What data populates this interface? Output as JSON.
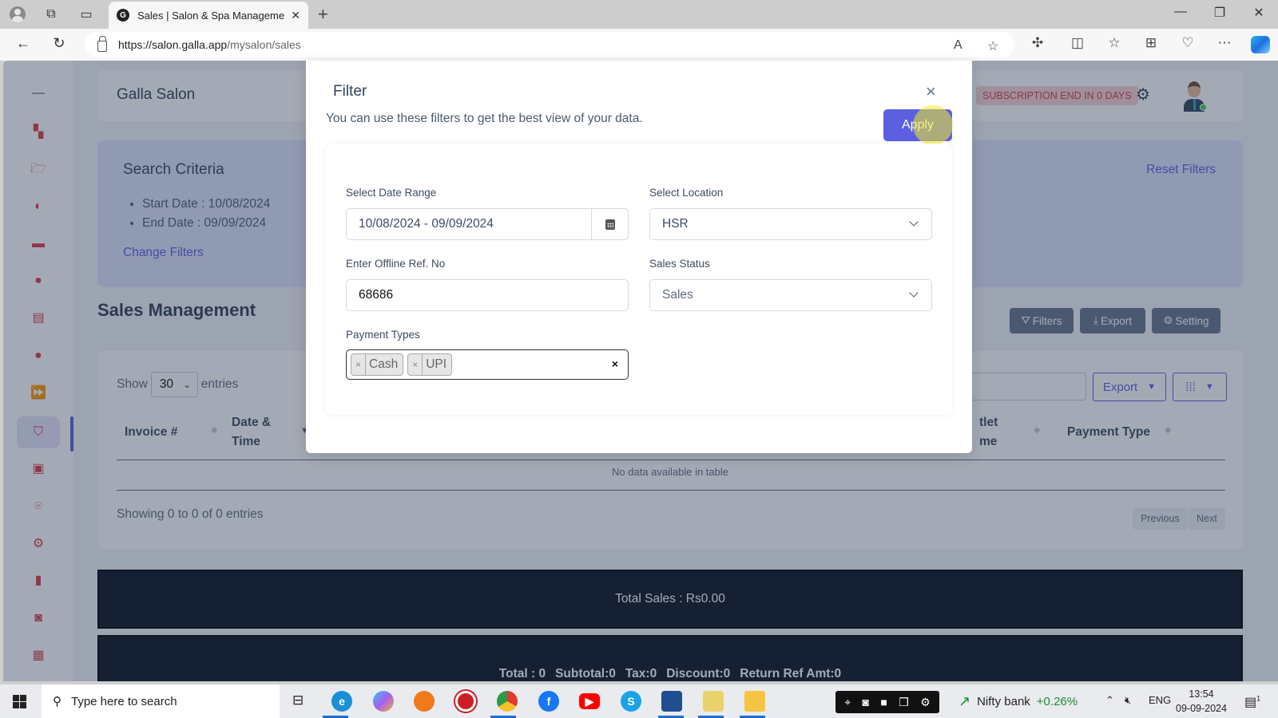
{
  "browser": {
    "tab_title": "Sales | Salon & Spa Management",
    "url_host": "https://salon.galla.app",
    "url_path": "/mysalon/sales",
    "new_tab": "+",
    "close_tab": "✕"
  },
  "header": {
    "brand": "Galla Salon",
    "subscription_badge": "SUBSCRIPTION END IN 0 DAYS",
    "subscription_color": "#d7373f"
  },
  "sidebar": {
    "items": [
      {
        "icon": "dashboard-icon",
        "glyph": "▚"
      },
      {
        "icon": "folder-open-icon",
        "glyph": "🗁"
      },
      {
        "icon": "contrast-icon",
        "glyph": "◐"
      },
      {
        "icon": "ticket-percent-icon",
        "glyph": "▬"
      },
      {
        "icon": "user-circle-icon",
        "glyph": "●"
      },
      {
        "icon": "document-icon",
        "glyph": "▤"
      },
      {
        "icon": "user-circle-icon",
        "glyph": "●"
      },
      {
        "icon": "fast-forward-circle-icon",
        "glyph": "⏩"
      },
      {
        "icon": "basket-icon",
        "glyph": "⛉",
        "active": true
      },
      {
        "icon": "contacts-book-icon",
        "glyph": "▣"
      },
      {
        "icon": "location-pin-icon",
        "glyph": "⌾"
      },
      {
        "icon": "gear-icon",
        "glyph": "⚙"
      },
      {
        "icon": "report-file-icon",
        "glyph": "▮"
      },
      {
        "icon": "cash-icon",
        "glyph": "◙"
      },
      {
        "icon": "calendar-icon",
        "glyph": "▦"
      }
    ],
    "accent_color": "#d93b48"
  },
  "criteria": {
    "title": "Search Criteria",
    "items": [
      "Start Date : 10/08/2024",
      "End Date : 09/09/2024"
    ],
    "change_link": "Change Filters",
    "reset_link": "Reset Filters"
  },
  "sales": {
    "title": "Sales Management",
    "actions": {
      "filters": "Filters",
      "export": "Export",
      "setting": "Setting"
    },
    "show_label": "Show",
    "entries_value": "30",
    "entries_label": "entries",
    "export_dropdown": "Export",
    "columns": [
      "Invoice #",
      "Date & Time",
      "Outlet Name",
      "Payment Type"
    ],
    "columns_visible_fragments": {
      "outlet": [
        "tlet",
        "me"
      ]
    },
    "empty_message": "No data available in table",
    "showing": "Showing 0 to 0 of 0 entries",
    "pagination": {
      "previous": "Previous",
      "next": "Next"
    }
  },
  "totals": {
    "total_sales": "Total Sales : Rs0.00",
    "summary": [
      "Total : 0",
      "Subtotal:0",
      "Tax:0",
      "Discount:0",
      "Return Ref Amt:0"
    ]
  },
  "filter_modal": {
    "title": "Filter",
    "subtitle": "You can use these filters to get the best view of your data.",
    "apply_label": "Apply",
    "apply_color": "#5b5fe0",
    "date_range_label": "Select Date Range",
    "date_range_value": "10/08/2024 - 09/09/2024",
    "location_label": "Select Location",
    "location_value": "HSR",
    "offline_ref_label": "Enter Offline Ref. No",
    "offline_ref_value": "68686",
    "sales_status_label": "Sales Status",
    "sales_status_value": "Sales",
    "payment_types_label": "Payment Types",
    "payment_types": [
      "Cash",
      "UPI"
    ]
  },
  "taskbar": {
    "search_placeholder": "Type here to search",
    "stock_name": "Nifty bank",
    "stock_change": "+0.26%",
    "language": "ENG",
    "time": "13:54",
    "date": "09-09-2024",
    "notification_count": "1"
  }
}
